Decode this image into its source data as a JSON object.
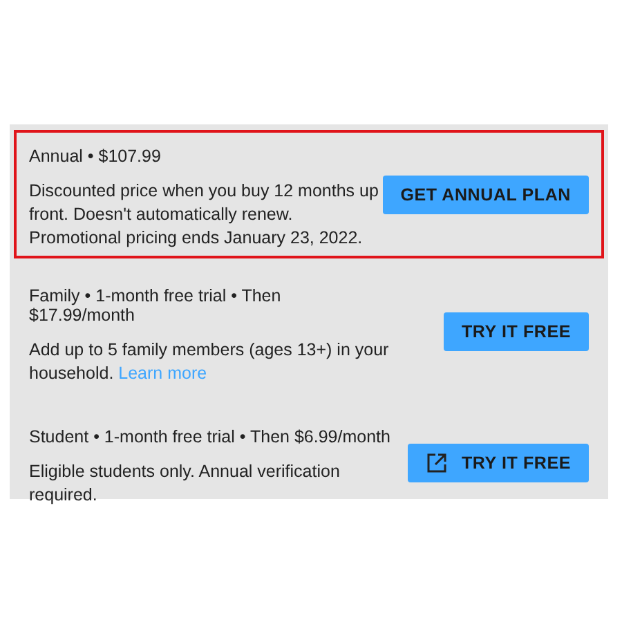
{
  "plans": [
    {
      "heading": "Annual • $107.99",
      "description": "Discounted price when you buy 12 months up front. Doesn't automatically renew. Promotional pricing ends January 23, 2022.",
      "button": "GET ANNUAL PLAN",
      "highlighted": true,
      "external": false
    },
    {
      "heading": "Family • 1-month free trial • Then $17.99/month",
      "description": "Add up to 5 family members (ages 13+) in your household.",
      "link": "Learn more",
      "button": "TRY IT FREE",
      "highlighted": false,
      "external": false
    },
    {
      "heading": "Student • 1-month free trial • Then $6.99/month",
      "description": "Eligible students only. Annual verification required.",
      "button": "TRY IT FREE",
      "highlighted": false,
      "external": true
    }
  ]
}
